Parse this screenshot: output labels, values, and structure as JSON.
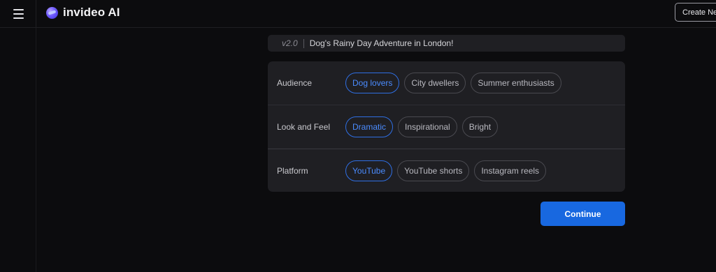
{
  "header": {
    "brand_name": "invideo AI",
    "create_label": "Create New"
  },
  "version": {
    "tag": "v2.0",
    "title": "Dog's Rainy Day Adventure in London!"
  },
  "settings": {
    "rows": [
      {
        "label": "Audience",
        "options": [
          "Dog lovers",
          "City dwellers",
          "Summer enthusiasts"
        ],
        "selected": "Dog lovers"
      },
      {
        "label": "Look and Feel",
        "options": [
          "Dramatic",
          "Inspirational",
          "Bright"
        ],
        "selected": "Dramatic"
      },
      {
        "label": "Platform",
        "options": [
          "YouTube",
          "YouTube shorts",
          "Instagram reels"
        ],
        "selected": "YouTube"
      }
    ]
  },
  "actions": {
    "continue_label": "Continue"
  },
  "colors": {
    "accent": "#1868e0",
    "selected_chip_text": "#4b8cff",
    "background": "#0c0c0e",
    "panel": "#1f1f23"
  },
  "icons": {
    "menu": "hamburger-menu-icon",
    "logo": "invideo-logo-icon"
  }
}
